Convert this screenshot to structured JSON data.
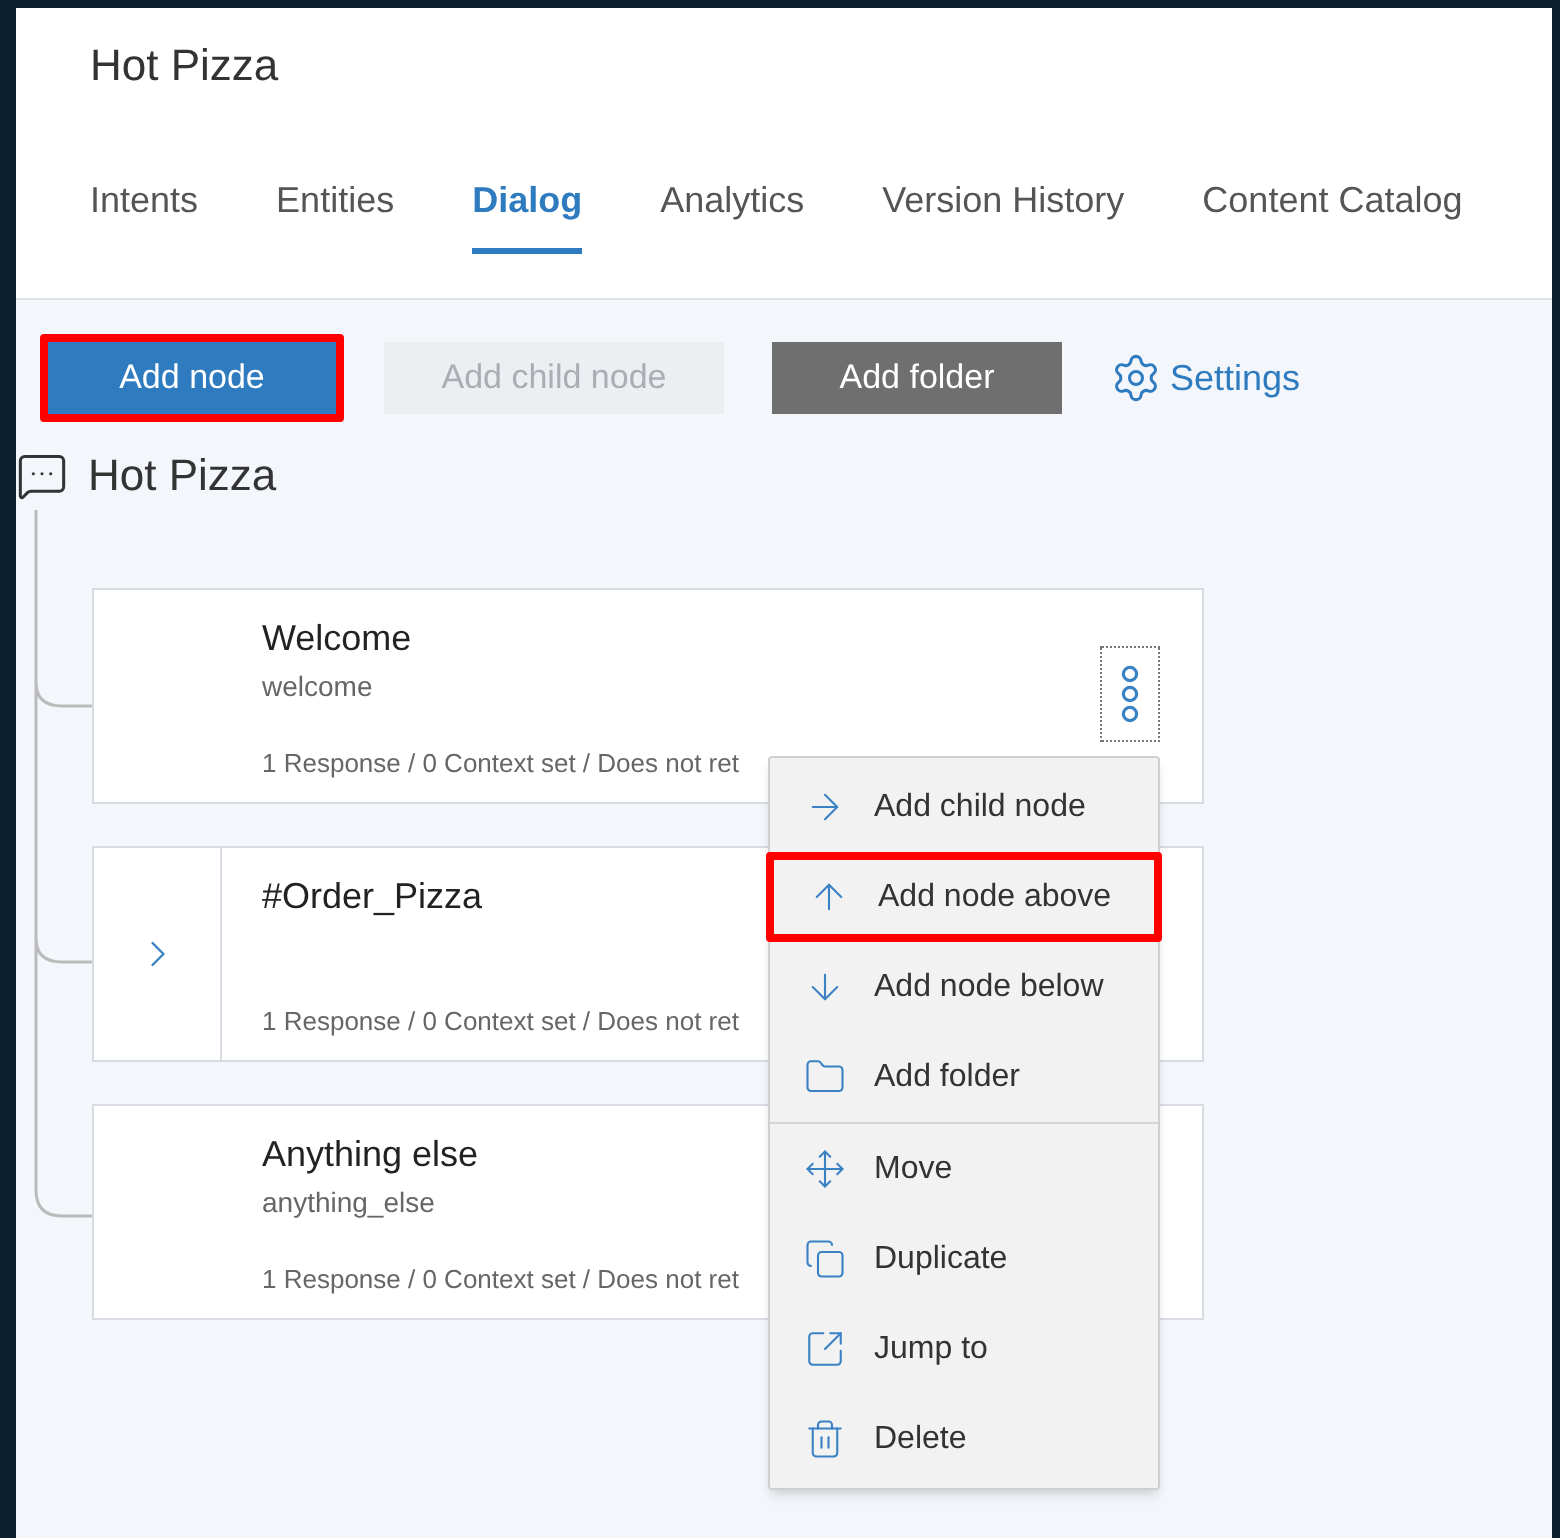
{
  "app_title": "Hot Pizza",
  "tabs": [
    {
      "label": "Intents",
      "selected": false
    },
    {
      "label": "Entities",
      "selected": false
    },
    {
      "label": "Dialog",
      "selected": true
    },
    {
      "label": "Analytics",
      "selected": false
    },
    {
      "label": "Version History",
      "selected": false
    },
    {
      "label": "Content Catalog",
      "selected": false
    }
  ],
  "toolbar": {
    "buttons": [
      {
        "label": "Add node",
        "kind": "primary",
        "disabled": false,
        "highlighted": true
      },
      {
        "label": "Add child node",
        "kind": "primary",
        "disabled": true,
        "highlighted": false
      },
      {
        "label": "Add folder",
        "kind": "dark",
        "disabled": false,
        "highlighted": false
      }
    ],
    "settings_link": "Settings"
  },
  "dialog_tree": {
    "root": "Hot Pizza",
    "nodes": [
      {
        "title": "Welcome",
        "condition": "welcome",
        "summary": "1 Response / 0 Context set / Does not ret",
        "expandable": false
      },
      {
        "title": "#Order_Pizza",
        "summary": "1 Response / 0 Context set / Does not ret",
        "expandable": true
      },
      {
        "title": "Anything else",
        "condition": "anything_else",
        "summary": "1 Response / 0 Context set / Does not ret",
        "expandable": false
      }
    ]
  },
  "context_menu": {
    "sections": [
      [
        {
          "label": "Add child node",
          "kind": "child",
          "highlighted": false
        },
        {
          "label": "Add node above",
          "kind": "above",
          "highlighted": true
        },
        {
          "label": "Add node below",
          "kind": "below",
          "highlighted": false
        },
        {
          "label": "Add folder",
          "kind": "folder",
          "highlighted": false
        }
      ],
      [
        {
          "label": "Move",
          "kind": "move",
          "highlighted": false
        },
        {
          "label": "Duplicate",
          "kind": "duplicate",
          "highlighted": false
        },
        {
          "label": "Jump to",
          "kind": "jump",
          "highlighted": false
        },
        {
          "label": "Delete",
          "kind": "delete",
          "highlighted": false
        }
      ]
    ]
  }
}
